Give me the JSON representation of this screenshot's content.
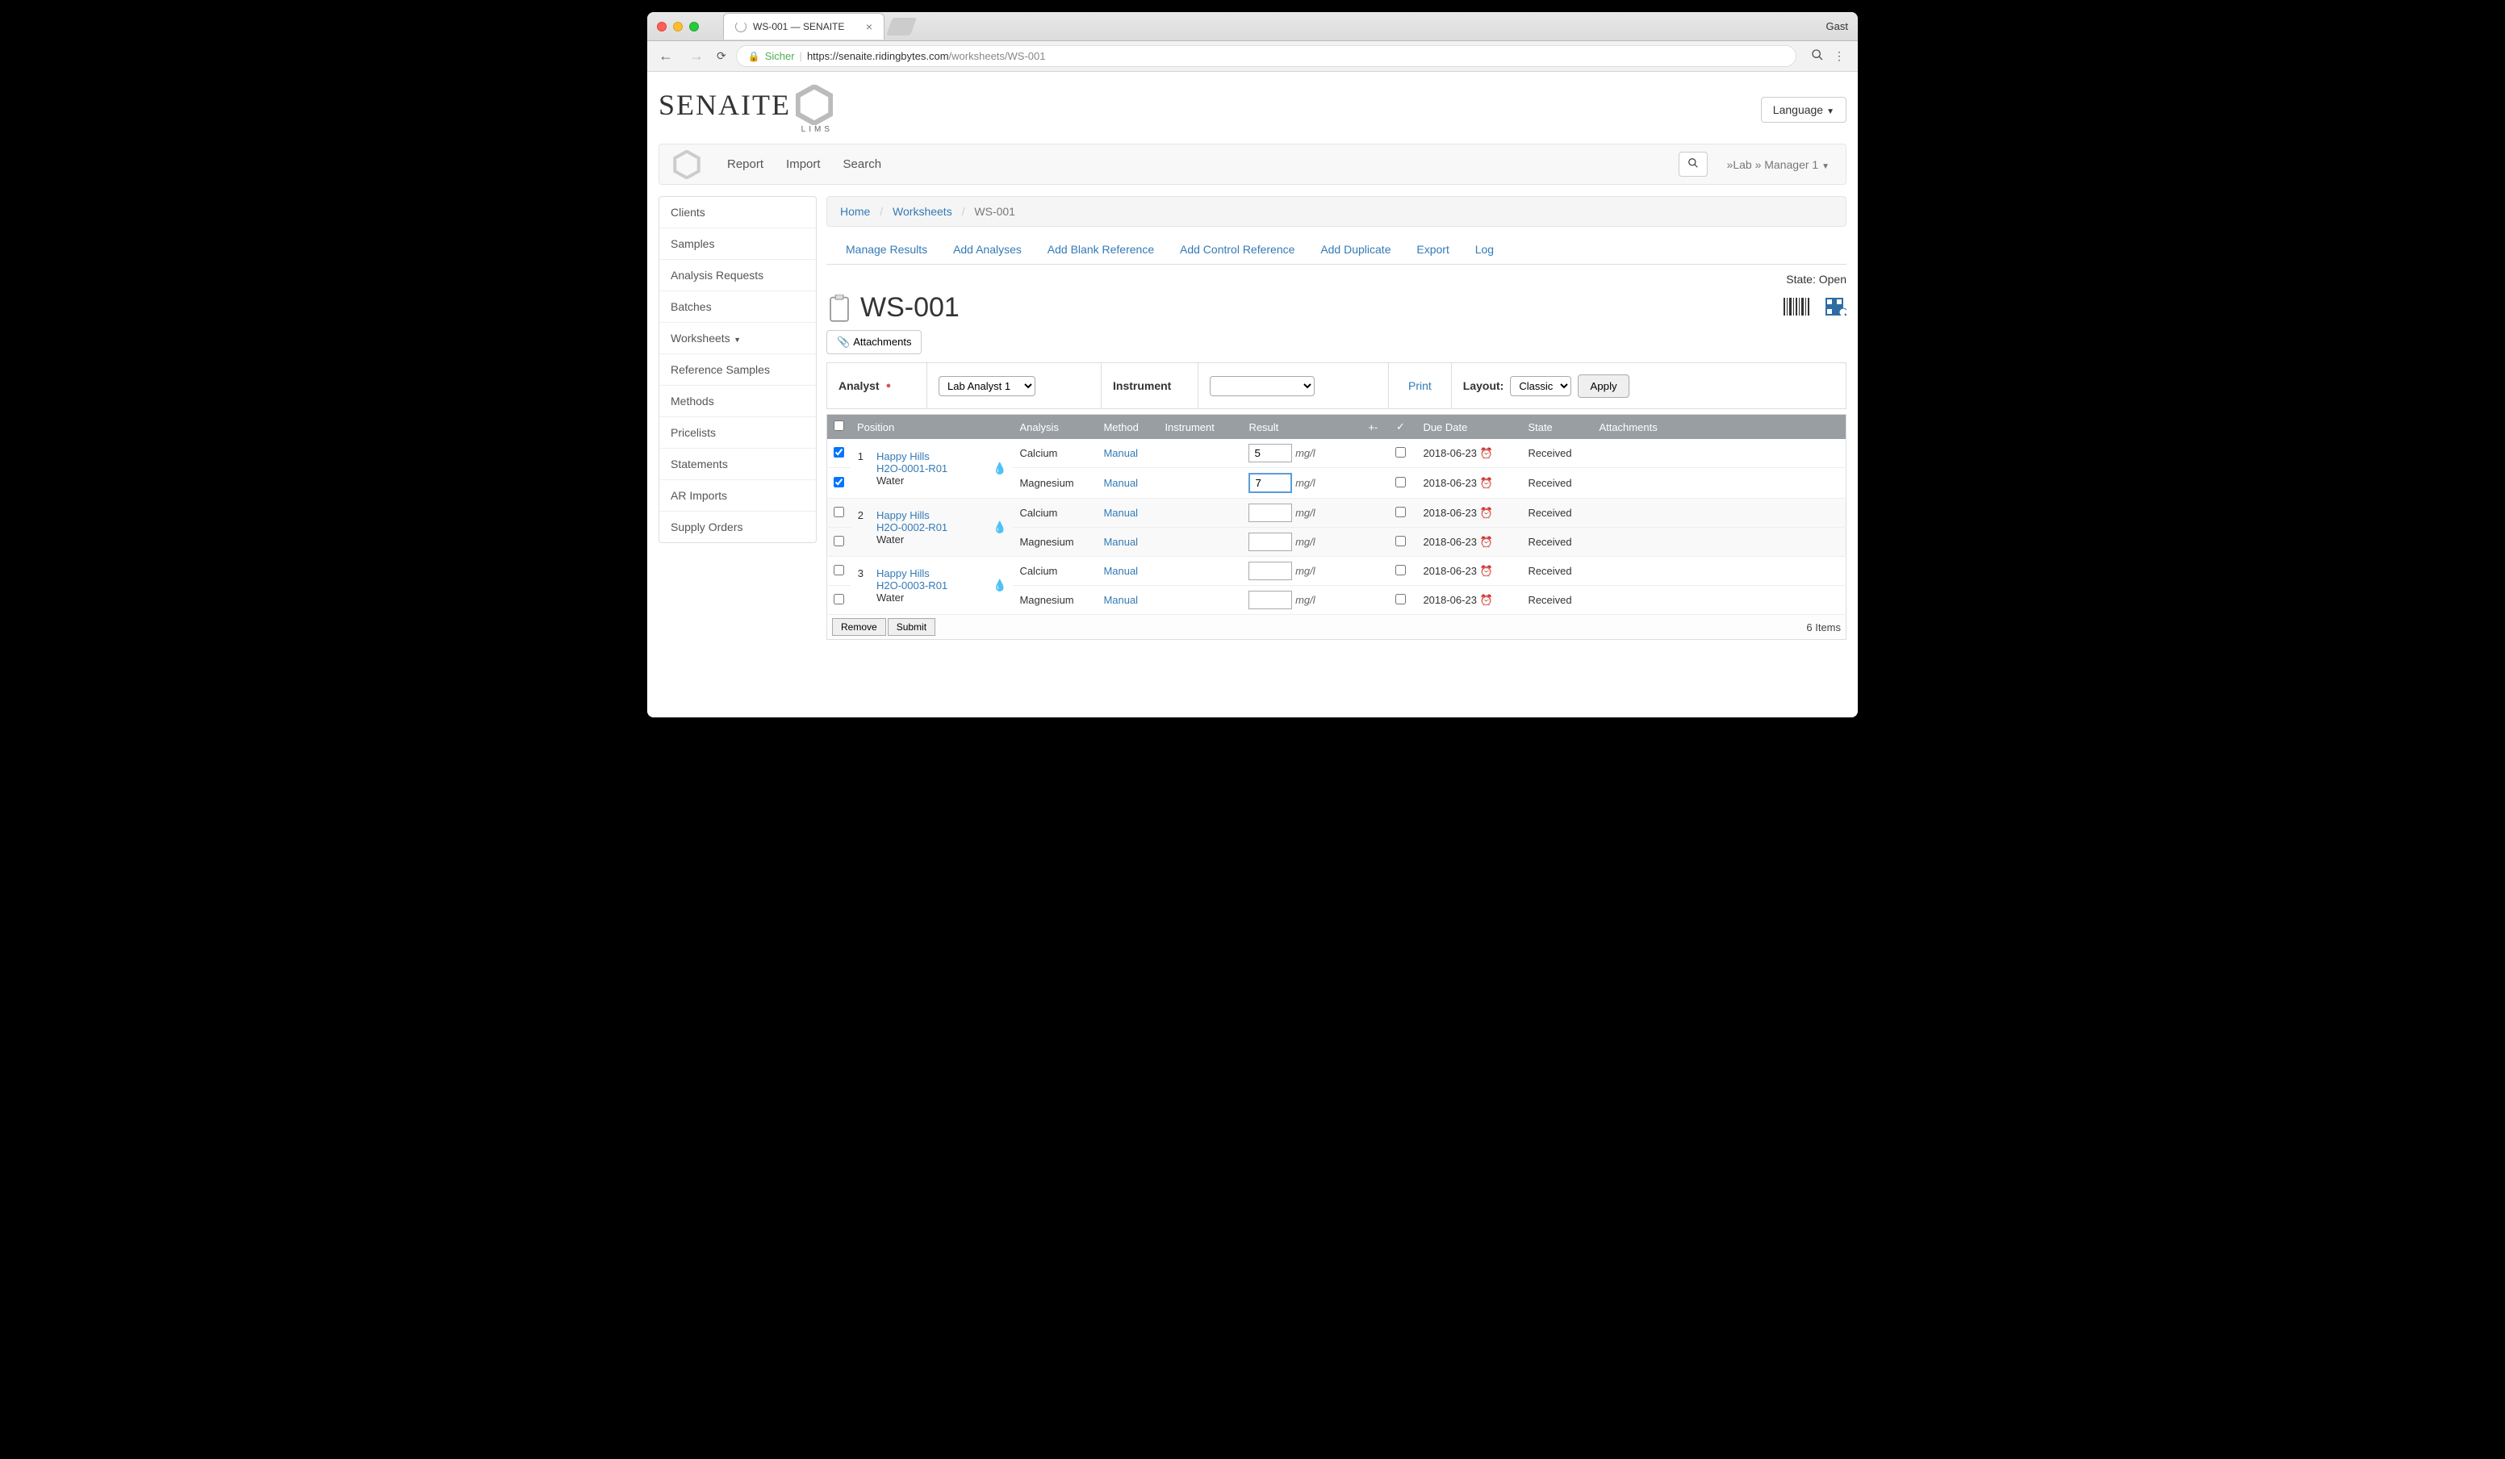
{
  "browser": {
    "tab_title": "WS-001 — SENAITE",
    "profile": "Gast",
    "url_secure": "Sicher",
    "url_proto": "https://",
    "url_host": "senaite.ridingbytes.com",
    "url_path": "/worksheets/WS-001"
  },
  "logo": {
    "text": "SENAITE",
    "sub": "LIMS"
  },
  "language_btn": "Language",
  "navbar": {
    "report": "Report",
    "import": "Import",
    "search": "Search",
    "user_menu": "»Lab » Manager 1"
  },
  "sidebar": {
    "items": [
      {
        "label": "Clients"
      },
      {
        "label": "Samples"
      },
      {
        "label": "Analysis Requests"
      },
      {
        "label": "Batches"
      },
      {
        "label": "Worksheets",
        "has_caret": true
      },
      {
        "label": "Reference Samples"
      },
      {
        "label": "Methods"
      },
      {
        "label": "Pricelists"
      },
      {
        "label": "Statements"
      },
      {
        "label": "AR Imports"
      },
      {
        "label": "Supply Orders"
      }
    ]
  },
  "breadcrumb": {
    "home": "Home",
    "worksheets": "Worksheets",
    "current": "WS-001"
  },
  "tabs": {
    "manage_results": "Manage Results",
    "add_analyses": "Add Analyses",
    "add_blank": "Add Blank Reference",
    "add_control": "Add Control Reference",
    "add_duplicate": "Add Duplicate",
    "export": "Export",
    "log": "Log"
  },
  "state_line": "State: Open",
  "page_title": "WS-001",
  "attachments_btn": "Attachments",
  "config": {
    "analyst_label": "Analyst",
    "analyst_value": "Lab Analyst 1",
    "instrument_label": "Instrument",
    "instrument_value": "",
    "print": "Print",
    "layout_label": "Layout:",
    "layout_value": "Classic",
    "apply": "Apply"
  },
  "table": {
    "headers": {
      "position": "Position",
      "analysis": "Analysis",
      "method": "Method",
      "instrument": "Instrument",
      "result": "Result",
      "due_date": "Due Date",
      "state": "State",
      "attachments": "Attachments"
    },
    "rows": [
      {
        "checked": true,
        "pos": "1",
        "client": "Happy Hills",
        "ar": "H2O-0001-R01",
        "sample": "Water",
        "first": true,
        "analysis": "Calcium",
        "method": "Manual",
        "result": "5",
        "active": false,
        "unit": "mg/l",
        "due": "2018-06-23",
        "state": "Received"
      },
      {
        "checked": true,
        "pos": "",
        "client": "",
        "ar": "",
        "sample": "",
        "first": false,
        "analysis": "Magnesium",
        "method": "Manual",
        "result": "7",
        "active": true,
        "unit": "mg/l",
        "due": "2018-06-23",
        "state": "Received"
      },
      {
        "checked": false,
        "pos": "2",
        "client": "Happy Hills",
        "ar": "H2O-0002-R01",
        "sample": "Water",
        "first": true,
        "analysis": "Calcium",
        "method": "Manual",
        "result": "",
        "active": false,
        "unit": "mg/l",
        "due": "2018-06-23",
        "state": "Received"
      },
      {
        "checked": false,
        "pos": "",
        "client": "",
        "ar": "",
        "sample": "",
        "first": false,
        "analysis": "Magnesium",
        "method": "Manual",
        "result": "",
        "active": false,
        "unit": "mg/l",
        "due": "2018-06-23",
        "state": "Received"
      },
      {
        "checked": false,
        "pos": "3",
        "client": "Happy Hills",
        "ar": "H2O-0003-R01",
        "sample": "Water",
        "first": true,
        "analysis": "Calcium",
        "method": "Manual",
        "result": "",
        "active": false,
        "unit": "mg/l",
        "due": "2018-06-23",
        "state": "Received"
      },
      {
        "checked": false,
        "pos": "",
        "client": "",
        "ar": "",
        "sample": "",
        "first": false,
        "analysis": "Magnesium",
        "method": "Manual",
        "result": "",
        "active": false,
        "unit": "mg/l",
        "due": "2018-06-23",
        "state": "Received"
      }
    ],
    "remove": "Remove",
    "submit": "Submit",
    "count": "6 Items"
  }
}
